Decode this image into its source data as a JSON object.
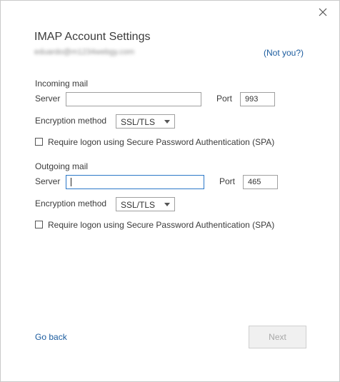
{
  "dialog": {
    "title": "IMAP Account Settings",
    "email": "eduardo@m1234webgy.com",
    "not_you_link": "(Not you?)"
  },
  "incoming": {
    "section_title": "Incoming mail",
    "server_label": "Server",
    "server_value": "",
    "port_label": "Port",
    "port_value": "993",
    "encryption_label": "Encryption method",
    "encryption_value": "SSL/TLS",
    "spa_label": "Require logon using Secure Password Authentication (SPA)",
    "spa_checked": false
  },
  "outgoing": {
    "section_title": "Outgoing mail",
    "server_label": "Server",
    "server_value": "",
    "port_label": "Port",
    "port_value": "465",
    "encryption_label": "Encryption method",
    "encryption_value": "SSL/TLS",
    "spa_label": "Require logon using Secure Password Authentication (SPA)",
    "spa_checked": false
  },
  "footer": {
    "go_back_label": "Go back",
    "next_label": "Next",
    "next_enabled": false
  },
  "icons": {
    "close": "close-icon",
    "dropdown": "chevron-down-icon"
  },
  "colors": {
    "link": "#1a5b9e",
    "focus_border": "#2b78c8",
    "disabled_text": "#a8a8a8"
  }
}
